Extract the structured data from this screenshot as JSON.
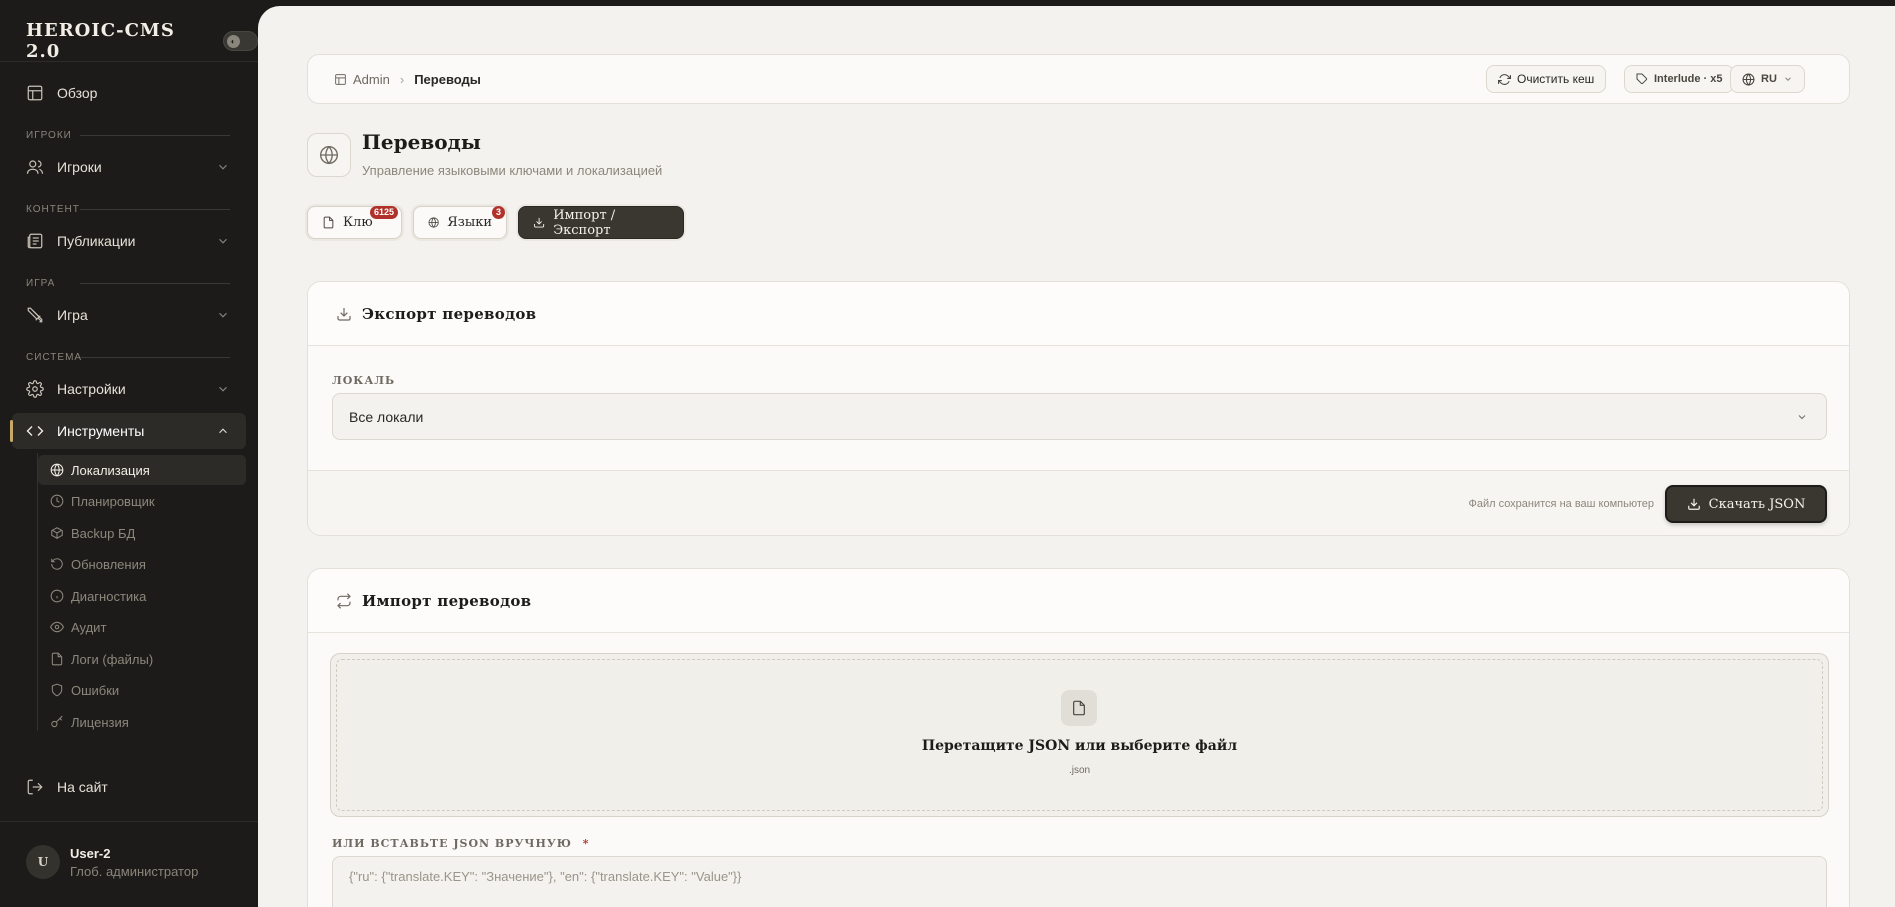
{
  "app": {
    "name": "HEROIC-CMS 2.0"
  },
  "sidebar": {
    "overview": "Обзор",
    "sections": {
      "players": "ИГРОКИ",
      "content": "КОНТЕНТ",
      "game": "ИГРА",
      "system": "СИСТЕМА"
    },
    "items": {
      "players": "Игроки",
      "publications": "Публикации",
      "game": "Игра",
      "settings": "Настройки",
      "tools": "Инструменты"
    },
    "tools_sub": [
      "Локализация",
      "Планировщик",
      "Backup БД",
      "Обновления",
      "Диагностика",
      "Аудит",
      "Логи (файлы)",
      "Ошибки",
      "Лицензия"
    ],
    "site_link": "На сайт",
    "user": {
      "initial": "U",
      "name": "User-2",
      "role": "Глоб. администратор"
    }
  },
  "topbar": {
    "breadcrumb": [
      "Admin",
      "Переводы"
    ],
    "clear_cache": "Очистить кеш",
    "server": "Interlude · x5",
    "lang": "RU"
  },
  "page": {
    "title": "Переводы",
    "subtitle": "Управление языковыми ключами и локализацией"
  },
  "tabs": [
    {
      "label": "Клю",
      "badge": "6125"
    },
    {
      "label": "Языки",
      "badge": "3"
    },
    {
      "label": "Импорт / Экспорт",
      "badge": ""
    }
  ],
  "export": {
    "title": "Экспорт переводов",
    "locale_label": "ЛОКАЛЬ",
    "locale_value": "Все локали",
    "hint": "Файл сохранится на ваш компьютер",
    "button": "Скачать JSON"
  },
  "import": {
    "title": "Импорт переводов",
    "drop_title": "Перетащите JSON или выберите файл",
    "drop_sub": ".json",
    "paste_label": "ИЛИ ВСТАВЬТЕ JSON ВРУЧНУЮ",
    "required_mark": "*",
    "placeholder": "{\"ru\": {\"translate.KEY\": \"Значение\"}, \"en\": {\"translate.KEY\": \"Value\"}}"
  },
  "colors": {
    "accent": "#c9a86a",
    "dark": "#3a3731",
    "badge": "#b0322a"
  }
}
